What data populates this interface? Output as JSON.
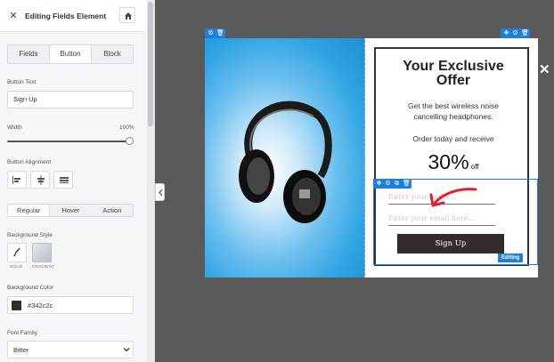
{
  "sidebar": {
    "title": "Editing Fields Element",
    "tabs": [
      "Fields",
      "Button",
      "Block"
    ],
    "active_tab": "Button",
    "button_text_label": "Button Text",
    "button_text_value": "Sign Up",
    "width_label": "Width",
    "width_value": "100%",
    "alignment_label": "Button Alignment",
    "state_tabs": [
      "Regular",
      "Hover",
      "Action"
    ],
    "bg_style_label": "Background Style",
    "bg_style_options": [
      "SOLID",
      "GRADIENT"
    ],
    "bg_color_label": "Background Color",
    "bg_color_value": "#342c2c",
    "font_family_label": "Font Family",
    "font_family_value": "Bitter"
  },
  "popup": {
    "headline_1": "Your Exclusive",
    "headline_2": "Offer",
    "body_1": "Get the best wireless noise",
    "body_2": "cancelling headphones.",
    "body_3": "Order today and receive",
    "offer_big": "30%",
    "offer_small": "off",
    "name_placeholder": "Enter your name...",
    "email_placeholder": "Enter your email here...",
    "button_label": "Sign Up",
    "editing_badge": "Editing"
  },
  "colors": {
    "accent": "#1f7fe0",
    "button_bg": "#342c2c",
    "canvas_bg": "#5a5a5a"
  }
}
